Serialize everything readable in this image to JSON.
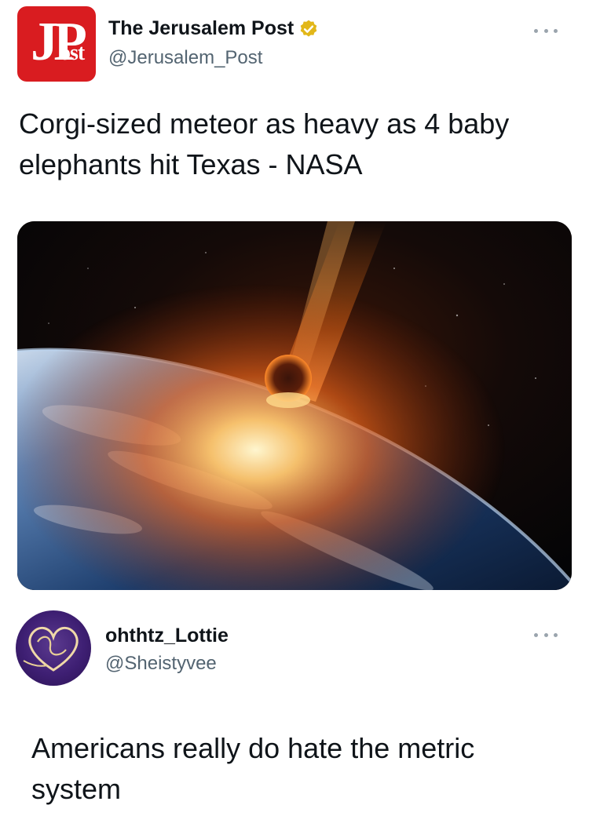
{
  "tweets": [
    {
      "display_name": "The Jerusalem Post",
      "handle": "@Jerusalem_Post",
      "verified": true,
      "avatar_text": {
        "big": "JP",
        "small": "ost"
      },
      "avatar_color": "#d91c20",
      "verified_color": "#e2b719",
      "text": "Corgi-sized meteor as heavy as 4 baby elephants hit Texas - NASA",
      "media": {
        "icon": "meteor-over-earth-image"
      }
    },
    {
      "display_name": "ohthtz_Lottie",
      "handle": "@Sheistyvee",
      "verified": false,
      "avatar_color": "#3e1f73",
      "text": "Americans really do hate the metric system"
    }
  ]
}
